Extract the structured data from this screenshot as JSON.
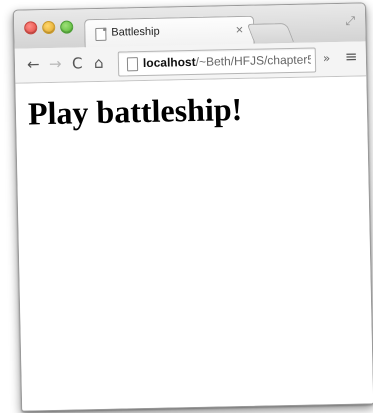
{
  "browser": {
    "tab": {
      "title": "Battleship",
      "close_glyph": "×"
    },
    "toolbar": {
      "back_glyph": "←",
      "forward_glyph": "→",
      "reload_glyph": "C",
      "home_glyph": "⌂",
      "url_host": "localhost",
      "url_path": "/~Beth/HFJS/chapter5...",
      "overflow_glyph": "»",
      "menu_glyph": "≡"
    },
    "icons": [
      "page-icon",
      "back-icon",
      "forward-icon",
      "reload-icon",
      "home-icon",
      "menu-icon",
      "fullscreen-icon"
    ]
  },
  "page": {
    "heading": "Play battleship!"
  }
}
